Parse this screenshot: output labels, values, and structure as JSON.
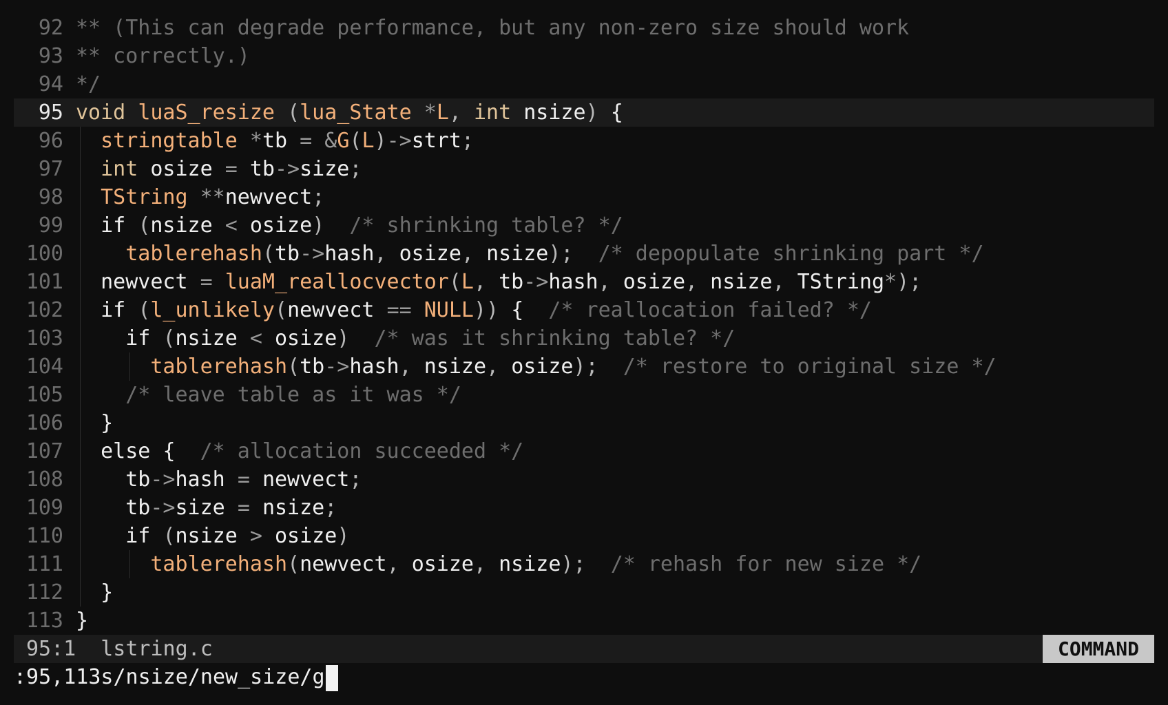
{
  "editor": {
    "current_line": 95,
    "lines": [
      {
        "n": "92",
        "g": 0,
        "t": [
          [
            "cm",
            "** (This can degrade performance, but any non-zero size should work"
          ]
        ]
      },
      {
        "n": "93",
        "g": 0,
        "t": [
          [
            "cm",
            "** correctly.)"
          ]
        ]
      },
      {
        "n": "94",
        "g": 0,
        "t": [
          [
            "cm",
            "*/"
          ]
        ]
      },
      {
        "n": "95",
        "g": 0,
        "t": [
          [
            "kw",
            "void"
          ],
          [
            "ws",
            " "
          ],
          [
            "fn",
            "luaS_resize"
          ],
          [
            "ws",
            " "
          ],
          [
            "punc",
            "("
          ],
          [
            "type",
            "lua_State"
          ],
          [
            "ws",
            " "
          ],
          [
            "op",
            "*"
          ],
          [
            "type",
            "L"
          ],
          [
            "punc",
            ","
          ],
          [
            "ws",
            " "
          ],
          [
            "kw",
            "int"
          ],
          [
            "ws",
            " "
          ],
          [
            "id",
            "nsize"
          ],
          [
            "punc",
            ")"
          ],
          [
            "ws",
            " "
          ],
          [
            "id",
            "{"
          ]
        ]
      },
      {
        "n": "96",
        "g": 1,
        "t": [
          [
            "ws",
            "  "
          ],
          [
            "type",
            "stringtable"
          ],
          [
            "ws",
            " "
          ],
          [
            "op",
            "*"
          ],
          [
            "id",
            "tb"
          ],
          [
            "ws",
            " "
          ],
          [
            "op",
            "="
          ],
          [
            "ws",
            " "
          ],
          [
            "op",
            "&"
          ],
          [
            "type",
            "G"
          ],
          [
            "punc",
            "("
          ],
          [
            "type",
            "L"
          ],
          [
            "punc",
            ")"
          ],
          [
            "op",
            "->"
          ],
          [
            "id",
            "strt"
          ],
          [
            "punc",
            ";"
          ]
        ]
      },
      {
        "n": "97",
        "g": 1,
        "t": [
          [
            "ws",
            "  "
          ],
          [
            "kw",
            "int"
          ],
          [
            "ws",
            " "
          ],
          [
            "id",
            "osize"
          ],
          [
            "ws",
            " "
          ],
          [
            "op",
            "="
          ],
          [
            "ws",
            " "
          ],
          [
            "id",
            "tb"
          ],
          [
            "op",
            "->"
          ],
          [
            "id",
            "size"
          ],
          [
            "punc",
            ";"
          ]
        ]
      },
      {
        "n": "98",
        "g": 1,
        "t": [
          [
            "ws",
            "  "
          ],
          [
            "type",
            "TString"
          ],
          [
            "ws",
            " "
          ],
          [
            "op",
            "**"
          ],
          [
            "id",
            "newvect"
          ],
          [
            "punc",
            ";"
          ]
        ]
      },
      {
        "n": "99",
        "g": 1,
        "t": [
          [
            "ws",
            "  "
          ],
          [
            "id",
            "if"
          ],
          [
            "ws",
            " "
          ],
          [
            "punc",
            "("
          ],
          [
            "id",
            "nsize"
          ],
          [
            "ws",
            " "
          ],
          [
            "op",
            "<"
          ],
          [
            "ws",
            " "
          ],
          [
            "id",
            "osize"
          ],
          [
            "punc",
            ")"
          ],
          [
            "ws",
            "  "
          ],
          [
            "cm",
            "/* shrinking table? */"
          ]
        ]
      },
      {
        "n": "100",
        "g": 1,
        "t": [
          [
            "ws",
            "    "
          ],
          [
            "fn",
            "tablerehash"
          ],
          [
            "punc",
            "("
          ],
          [
            "id",
            "tb"
          ],
          [
            "op",
            "->"
          ],
          [
            "id",
            "hash"
          ],
          [
            "punc",
            ","
          ],
          [
            "ws",
            " "
          ],
          [
            "id",
            "osize"
          ],
          [
            "punc",
            ","
          ],
          [
            "ws",
            " "
          ],
          [
            "id",
            "nsize"
          ],
          [
            "punc",
            ");"
          ],
          [
            "ws",
            "  "
          ],
          [
            "cm",
            "/* depopulate shrinking part */"
          ]
        ]
      },
      {
        "n": "101",
        "g": 1,
        "t": [
          [
            "ws",
            "  "
          ],
          [
            "id",
            "newvect"
          ],
          [
            "ws",
            " "
          ],
          [
            "op",
            "="
          ],
          [
            "ws",
            " "
          ],
          [
            "fn",
            "luaM_reallocvector"
          ],
          [
            "punc",
            "("
          ],
          [
            "type",
            "L"
          ],
          [
            "punc",
            ","
          ],
          [
            "ws",
            " "
          ],
          [
            "id",
            "tb"
          ],
          [
            "op",
            "->"
          ],
          [
            "id",
            "hash"
          ],
          [
            "punc",
            ","
          ],
          [
            "ws",
            " "
          ],
          [
            "id",
            "osize"
          ],
          [
            "punc",
            ","
          ],
          [
            "ws",
            " "
          ],
          [
            "id",
            "nsize"
          ],
          [
            "punc",
            ","
          ],
          [
            "ws",
            " "
          ],
          [
            "id",
            "TString"
          ],
          [
            "op",
            "*"
          ],
          [
            "punc",
            ");"
          ]
        ]
      },
      {
        "n": "102",
        "g": 1,
        "t": [
          [
            "ws",
            "  "
          ],
          [
            "id",
            "if"
          ],
          [
            "ws",
            " "
          ],
          [
            "punc",
            "("
          ],
          [
            "fn",
            "l_unlikely"
          ],
          [
            "punc",
            "("
          ],
          [
            "id",
            "newvect"
          ],
          [
            "ws",
            " "
          ],
          [
            "op",
            "=="
          ],
          [
            "ws",
            " "
          ],
          [
            "type",
            "NULL"
          ],
          [
            "punc",
            "))"
          ],
          [
            "ws",
            " "
          ],
          [
            "id",
            "{"
          ],
          [
            "ws",
            "  "
          ],
          [
            "cm",
            "/* reallocation failed? */"
          ]
        ]
      },
      {
        "n": "103",
        "g": 1,
        "t": [
          [
            "ws",
            "    "
          ],
          [
            "id",
            "if"
          ],
          [
            "ws",
            " "
          ],
          [
            "punc",
            "("
          ],
          [
            "id",
            "nsize"
          ],
          [
            "ws",
            " "
          ],
          [
            "op",
            "<"
          ],
          [
            "ws",
            " "
          ],
          [
            "id",
            "osize"
          ],
          [
            "punc",
            ")"
          ],
          [
            "ws",
            "  "
          ],
          [
            "cm",
            "/* was it shrinking table? */"
          ]
        ]
      },
      {
        "n": "104",
        "g": 2,
        "t": [
          [
            "ws",
            "      "
          ],
          [
            "fn",
            "tablerehash"
          ],
          [
            "punc",
            "("
          ],
          [
            "id",
            "tb"
          ],
          [
            "op",
            "->"
          ],
          [
            "id",
            "hash"
          ],
          [
            "punc",
            ","
          ],
          [
            "ws",
            " "
          ],
          [
            "id",
            "nsize"
          ],
          [
            "punc",
            ","
          ],
          [
            "ws",
            " "
          ],
          [
            "id",
            "osize"
          ],
          [
            "punc",
            ");"
          ],
          [
            "ws",
            "  "
          ],
          [
            "cm",
            "/* restore to original size */"
          ]
        ]
      },
      {
        "n": "105",
        "g": 1,
        "t": [
          [
            "ws",
            "    "
          ],
          [
            "cm",
            "/* leave table as it was */"
          ]
        ]
      },
      {
        "n": "106",
        "g": 1,
        "t": [
          [
            "ws",
            "  "
          ],
          [
            "id",
            "}"
          ]
        ]
      },
      {
        "n": "107",
        "g": 1,
        "t": [
          [
            "ws",
            "  "
          ],
          [
            "id",
            "else"
          ],
          [
            "ws",
            " "
          ],
          [
            "id",
            "{"
          ],
          [
            "ws",
            "  "
          ],
          [
            "cm",
            "/* allocation succeeded */"
          ]
        ]
      },
      {
        "n": "108",
        "g": 1,
        "t": [
          [
            "ws",
            "    "
          ],
          [
            "id",
            "tb"
          ],
          [
            "op",
            "->"
          ],
          [
            "id",
            "hash"
          ],
          [
            "ws",
            " "
          ],
          [
            "op",
            "="
          ],
          [
            "ws",
            " "
          ],
          [
            "id",
            "newvect"
          ],
          [
            "punc",
            ";"
          ]
        ]
      },
      {
        "n": "109",
        "g": 1,
        "t": [
          [
            "ws",
            "    "
          ],
          [
            "id",
            "tb"
          ],
          [
            "op",
            "->"
          ],
          [
            "id",
            "size"
          ],
          [
            "ws",
            " "
          ],
          [
            "op",
            "="
          ],
          [
            "ws",
            " "
          ],
          [
            "id",
            "nsize"
          ],
          [
            "punc",
            ";"
          ]
        ]
      },
      {
        "n": "110",
        "g": 1,
        "t": [
          [
            "ws",
            "    "
          ],
          [
            "id",
            "if"
          ],
          [
            "ws",
            " "
          ],
          [
            "punc",
            "("
          ],
          [
            "id",
            "nsize"
          ],
          [
            "ws",
            " "
          ],
          [
            "op",
            ">"
          ],
          [
            "ws",
            " "
          ],
          [
            "id",
            "osize"
          ],
          [
            "punc",
            ")"
          ]
        ]
      },
      {
        "n": "111",
        "g": 2,
        "t": [
          [
            "ws",
            "      "
          ],
          [
            "fn",
            "tablerehash"
          ],
          [
            "punc",
            "("
          ],
          [
            "id",
            "newvect"
          ],
          [
            "punc",
            ","
          ],
          [
            "ws",
            " "
          ],
          [
            "id",
            "osize"
          ],
          [
            "punc",
            ","
          ],
          [
            "ws",
            " "
          ],
          [
            "id",
            "nsize"
          ],
          [
            "punc",
            ");"
          ],
          [
            "ws",
            "  "
          ],
          [
            "cm",
            "/* rehash for new size */"
          ]
        ]
      },
      {
        "n": "112",
        "g": 1,
        "t": [
          [
            "ws",
            "  "
          ],
          [
            "id",
            "}"
          ]
        ]
      },
      {
        "n": "113",
        "g": 0,
        "t": [
          [
            "id",
            "}"
          ]
        ]
      }
    ]
  },
  "status": {
    "position": "95:1",
    "filename": "lstring.c",
    "mode": "COMMAND"
  },
  "cmdline": {
    "text": ":95,113s/nsize/new_size/g"
  },
  "colors": {
    "background": "#0e0e0e",
    "keyword": "#e0c49a",
    "function": "#f3b07a",
    "comment": "#6e6e6e",
    "mode_badge": "#c8c8c8"
  }
}
